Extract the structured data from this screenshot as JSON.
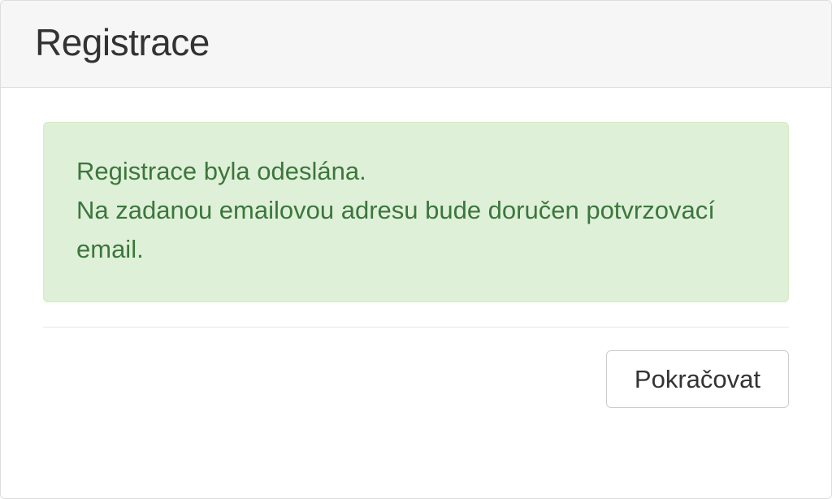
{
  "header": {
    "title": "Registrace"
  },
  "alert": {
    "line1": "Registrace byla odeslána.",
    "line2": "Na zadanou emailovou adresu bude doručen potvrzovací email."
  },
  "footer": {
    "continue_label": "Pokračovat"
  }
}
